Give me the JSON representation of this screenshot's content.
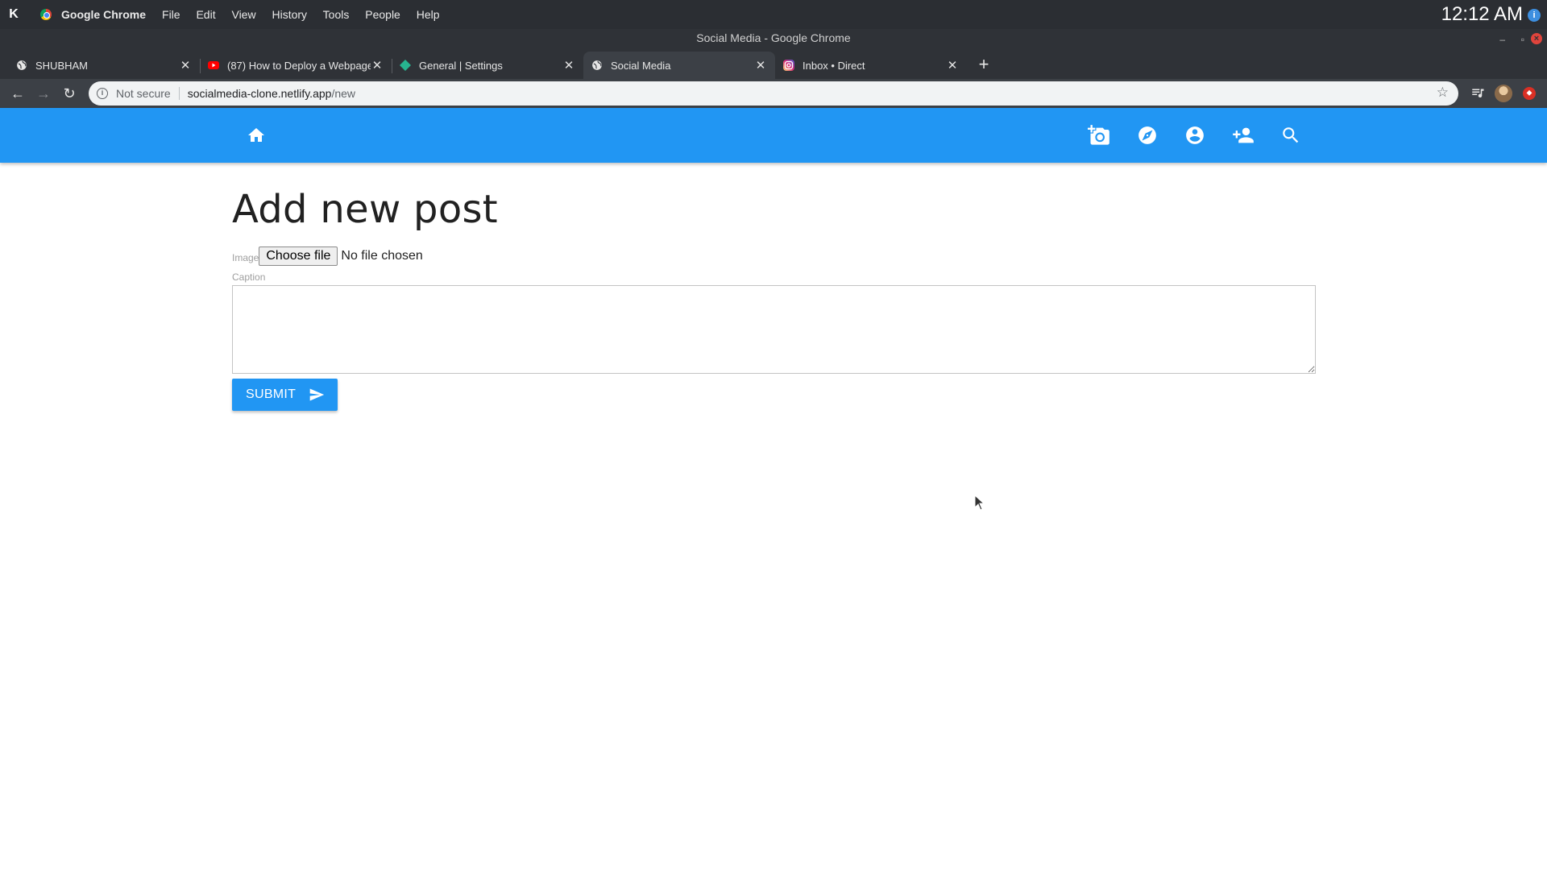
{
  "system": {
    "kde_glyph": "K",
    "app_name": "Google Chrome",
    "menu": [
      "File",
      "Edit",
      "View",
      "History",
      "Tools",
      "People",
      "Help"
    ],
    "clock": "12:12 AM",
    "notification_glyph": "i"
  },
  "window": {
    "title": "Social Media - Google Chrome",
    "min_glyph": "–",
    "max_glyph": "▫",
    "close_glyph": "×"
  },
  "tabs": [
    {
      "label": "SHUBHAM",
      "icon": "globe-icon",
      "active": false
    },
    {
      "label": "(87) How to Deploy a Webpage",
      "icon": "youtube-icon",
      "active": false
    },
    {
      "label": "General | Settings",
      "icon": "diamond-icon",
      "active": false
    },
    {
      "label": "Social Media",
      "icon": "globe-icon",
      "active": true
    },
    {
      "label": "Inbox • Direct",
      "icon": "instagram-icon",
      "active": false
    }
  ],
  "tab_close_glyph": "✕",
  "new_tab_glyph": "+",
  "toolbar": {
    "back": "←",
    "forward": "→",
    "reload": "↻",
    "security_label": "Not secure",
    "info_glyph": "i",
    "url_host": "socialmedia-clone.netlify.app",
    "url_path": "/new",
    "star": "☆",
    "red_ext_glyph": "⬥"
  },
  "appbar": {
    "icons": [
      "home-icon",
      "add-a-photo-icon",
      "explore-icon",
      "account-circle-icon",
      "person-add-icon",
      "search-icon"
    ],
    "color": "#2196f3"
  },
  "page": {
    "title": "Add new post",
    "image_label": "Image",
    "file_button": "Choose file",
    "file_status": "No file chosen",
    "caption_label": "Caption",
    "caption_value": "",
    "submit_label": "SUBMIT"
  }
}
